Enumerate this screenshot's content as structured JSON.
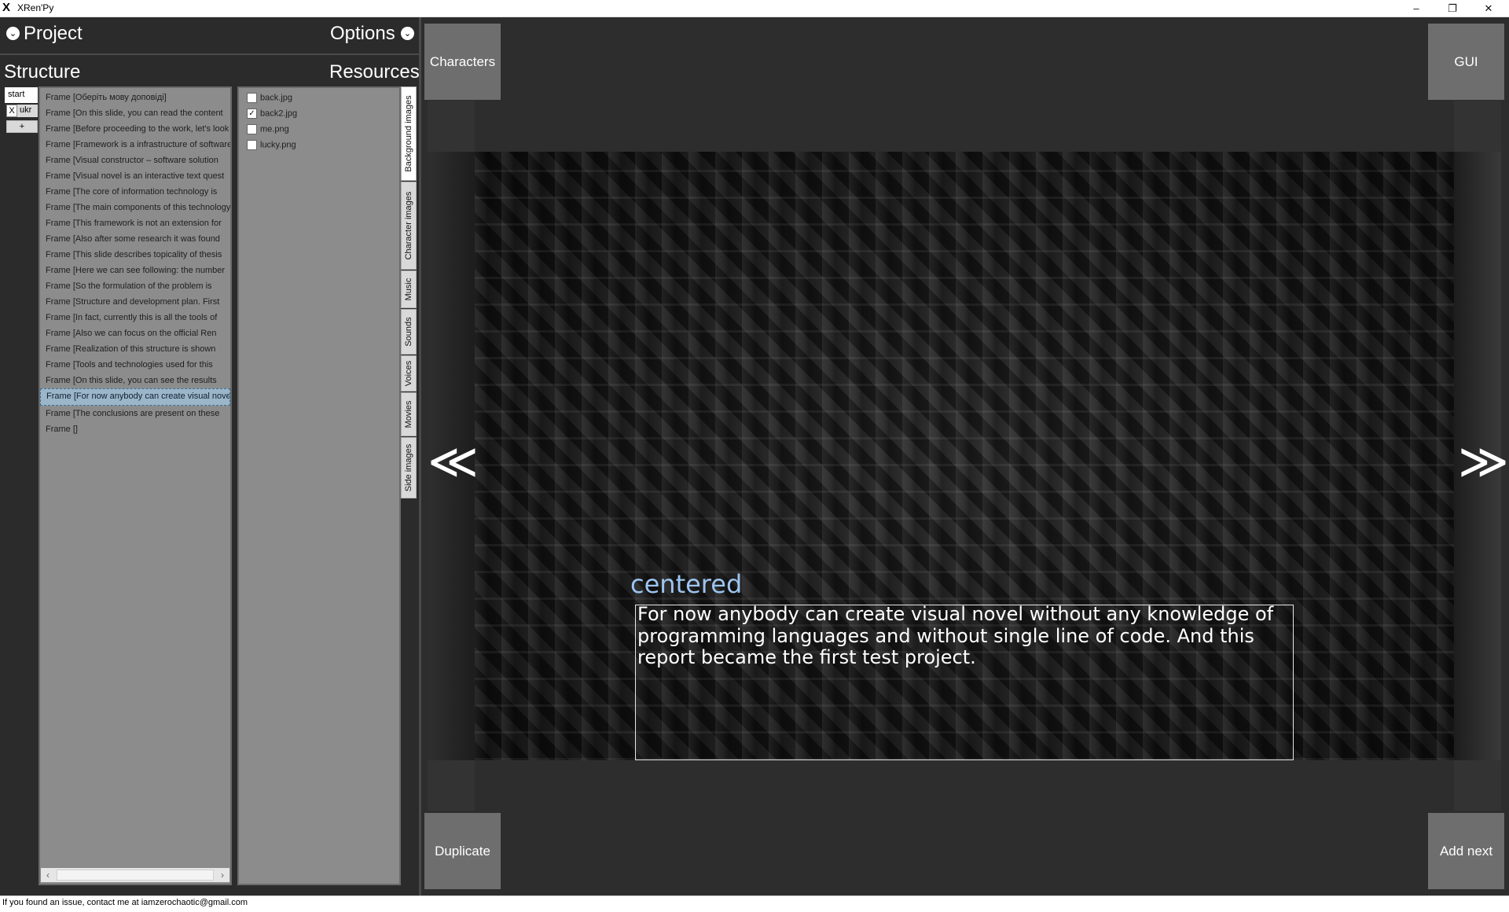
{
  "window": {
    "title": "XRen'Py",
    "logo": "X",
    "minimize": "–",
    "maximize": "❐",
    "close": "✕"
  },
  "header": {
    "project_label": "Project",
    "options_label": "Options",
    "chevron_icon": "chevron-down-icon"
  },
  "left": {
    "structure_label": "Structure",
    "resources_label": "Resources"
  },
  "languages": {
    "start": "start",
    "remove": "X",
    "ukr": "ukr",
    "add": "+"
  },
  "frames": [
    "Frame [Оберіть мову доповіді]",
    "Frame [On this slide, you can read the content",
    "Frame [Before proceeding to the work, let's look",
    "Frame [Framework is a infrastructure of software",
    "Frame [Visual constructor – software solution",
    "Frame [Visual novel is an interactive text quest",
    "Frame [The core of information technology is",
    "Frame [The main components of this technology",
    "Frame [This framework is not an extension for",
    "Frame [Also after some research it was found",
    "Frame [This slide describes topicality of thesis",
    "Frame [Here we can see following: the number",
    "Frame [So the formulation of the problem is",
    "Frame [Structure and development plan. First",
    "Frame [In fact, currently this is all the tools of",
    "Frame [Also we can focus on the official Ren",
    "Frame [Realization of this structure is shown",
    "Frame [Tools and technologies used for this",
    "Frame [On this slide, you can see the results",
    "Frame [For now anybody can create visual novel",
    "Frame [The conclusions are present on these",
    "Frame []"
  ],
  "selected_frame_index": 19,
  "scrollbar": {
    "left": "‹",
    "right": "›"
  },
  "resources": [
    {
      "name": "back.jpg",
      "checked": false
    },
    {
      "name": "back2.jpg",
      "checked": true
    },
    {
      "name": "me.png",
      "checked": false
    },
    {
      "name": "lucky.png",
      "checked": false
    }
  ],
  "resource_tabs": [
    "Background images",
    "Character images",
    "Music",
    "Sounds",
    "Voices",
    "Movies",
    "Side images"
  ],
  "active_resource_tab": 0,
  "buttons": {
    "characters": "Characters",
    "gui": "GUI",
    "duplicate": "Duplicate",
    "add_next": "Add next",
    "prev": "≪",
    "next": "≫"
  },
  "preview": {
    "speaker": "centered",
    "text": "For now anybody can create visual novel without any knowledge of programming languages and without single line of code. And this report became the first test project."
  },
  "status": {
    "text": "If you found an issue, contact me at iamzerochaotic@gmail.com"
  },
  "colors": {
    "speaker": "#9cc4f0",
    "selection": "#9bb6c8",
    "panel_bg": "#2b2b2b",
    "button_bg": "#6e6e6e"
  }
}
